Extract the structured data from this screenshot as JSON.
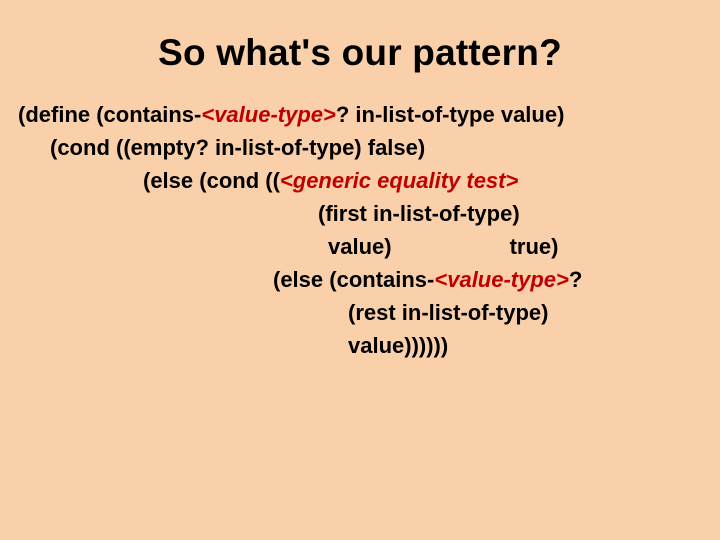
{
  "title": "So what's our pattern?",
  "code": {
    "l1a": "(define (contains-",
    "l1_vt": "<value-type>",
    "l1b": "? in-list-of-type value)",
    "l2": "(cond ((empty? in-list-of-type) false)",
    "l3a": "(else (cond ((",
    "l3_gen": "<generic equality test>",
    "l4": "(first in-list-of-type)",
    "l5a": "value)",
    "l5b": "true)",
    "l6a": "(else (contains-",
    "l6_vt": "<value-type>",
    "l6b": "?",
    "l7": "(rest in-list-of-type)",
    "l8": "value))))))"
  }
}
